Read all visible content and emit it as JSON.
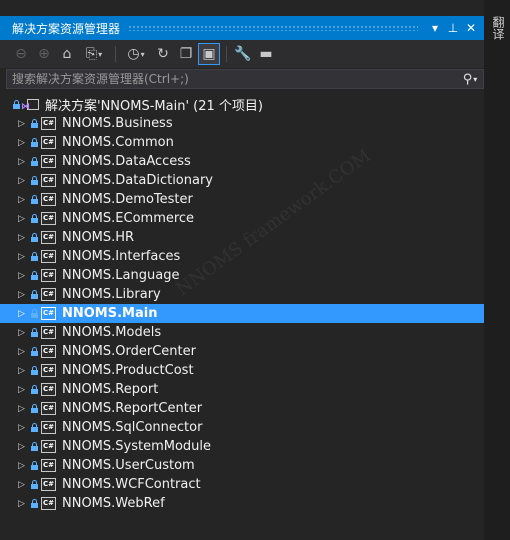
{
  "window": {
    "title": "解决方案资源管理器"
  },
  "titlebar_buttons": [
    {
      "name": "dropdown-icon",
      "glyph": "▾"
    },
    {
      "name": "pin-icon",
      "glyph": "⊥"
    },
    {
      "name": "close-icon",
      "glyph": "✕"
    }
  ],
  "toolbar": {
    "buttons": [
      {
        "name": "back-icon",
        "glyph": "⊖",
        "dim": true
      },
      {
        "name": "forward-icon",
        "glyph": "⊕",
        "dim": true
      },
      {
        "name": "home-icon",
        "glyph": "⌂"
      },
      {
        "name": "switch-views-icon",
        "glyph": "⎘",
        "dropdown": true
      },
      {
        "sep": true
      },
      {
        "name": "pending-changes-filter-icon",
        "glyph": "◷",
        "dropdown": true
      },
      {
        "name": "sync-icon",
        "glyph": "↻"
      },
      {
        "name": "collapse-all-icon",
        "glyph": "❐"
      },
      {
        "name": "show-all-files-icon",
        "glyph": "▣",
        "active": true
      },
      {
        "sep": true
      },
      {
        "name": "properties-icon",
        "glyph": "🔧"
      },
      {
        "name": "preview-icon",
        "glyph": "▬"
      }
    ]
  },
  "search": {
    "placeholder": "搜索解决方案资源管理器(Ctrl+;)"
  },
  "solution": {
    "label": "解决方案'NNOMS-Main' (21 个项目)"
  },
  "projects": [
    {
      "label": "NNOMS.Business"
    },
    {
      "label": "NNOMS.Common"
    },
    {
      "label": "NNOMS.DataAccess"
    },
    {
      "label": "NNOMS.DataDictionary"
    },
    {
      "label": "NNOMS.DemoTester"
    },
    {
      "label": "NNOMS.ECommerce"
    },
    {
      "label": "NNOMS.HR"
    },
    {
      "label": "NNOMS.Interfaces"
    },
    {
      "label": "NNOMS.Language"
    },
    {
      "label": "NNOMS.Library"
    },
    {
      "label": "NNOMS.Main",
      "selected": true
    },
    {
      "label": "NNOMS.Models"
    },
    {
      "label": "NNOMS.OrderCenter"
    },
    {
      "label": "NNOMS.ProductCost"
    },
    {
      "label": "NNOMS.Report"
    },
    {
      "label": "NNOMS.ReportCenter"
    },
    {
      "label": "NNOMS.SqlConnector"
    },
    {
      "label": "NNOMS.SystemModule"
    },
    {
      "label": "NNOMS.UserCustom"
    },
    {
      "label": "NNOMS.WCFContract"
    },
    {
      "label": "NNOMS.WebRef"
    }
  ],
  "project_badge": "C#",
  "side_tab": {
    "label": "翻译"
  },
  "watermark": {
    "text": "www.cnblogs.com/NNOMS framework.COM"
  },
  "colors": {
    "accent": "#007acc",
    "selection": "#3399ff",
    "panel": "#252526"
  }
}
